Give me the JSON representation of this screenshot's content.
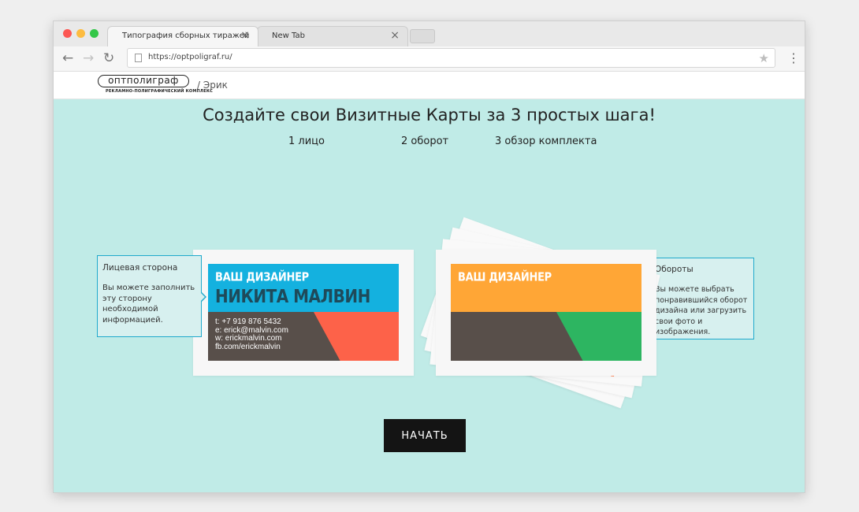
{
  "browser": {
    "tabs": [
      {
        "title": "Типография сборных тиражей",
        "close": "×"
      },
      {
        "title": "New Tab",
        "close": "×"
      }
    ],
    "nav": {
      "back": "←",
      "forward": "→",
      "reload": "↻",
      "menu": "⋮"
    },
    "url": "https://optpoligraf.ru/",
    "bookmark_icon": "★"
  },
  "site": {
    "logo_text": "оптполиграф",
    "logo_subtitle": "РЕКЛАМНО-ПОЛИГРАФИЧЕСКИЙ КОМПЛЕКС",
    "breadcrumb": "/ Эрик"
  },
  "main": {
    "headline": "Создайте свои Визитные Карты за 3 простых шага!",
    "steps": [
      "1 лицо",
      "2 оборот",
      "3 обзор комплекта"
    ],
    "front_callout": {
      "title": "Лицевая сторона",
      "body": "Вы можете заполнить эту сторону необходимой информацией."
    },
    "back_callout": {
      "title": "Обороты",
      "body": "Вы можете выбрать понравившийся оборот дизайна или загрузить свои фото и изображения."
    },
    "front_card": {
      "role": "ВАШ ДИЗАЙНЕР",
      "name": "НИКИТА МАЛВИН",
      "contacts": [
        "t: +7 919 876 5432",
        "e: erick@malvin.com",
        "w: erickmalvin.com",
        "fb.com/erickmalvin"
      ],
      "colors": {
        "top": "#14b1df",
        "bottom": "#584f4a",
        "accent": "#fd6249"
      }
    },
    "back_card": {
      "role": "ВАШ ДИЗАЙНЕР",
      "colors": {
        "top": "#ffa636",
        "bottom": "#584f4a",
        "accent": "#2db561"
      }
    },
    "start_button": "НАЧАТЬ"
  }
}
